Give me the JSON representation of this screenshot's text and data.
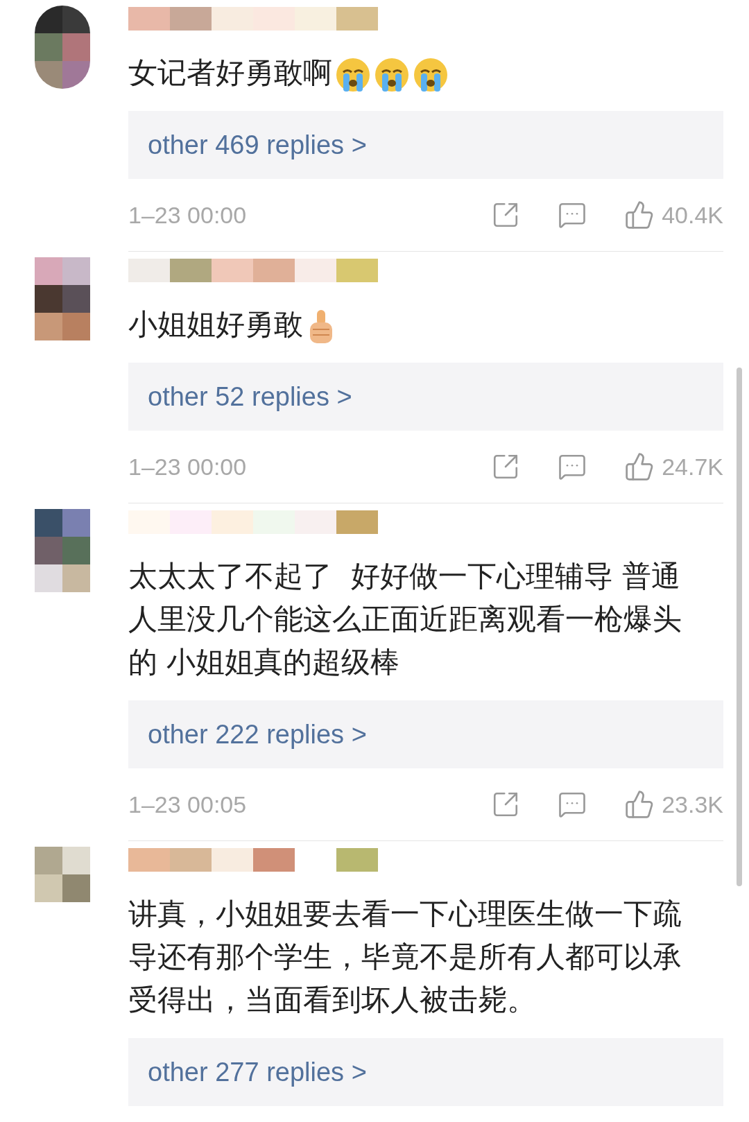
{
  "comments": [
    {
      "text": "女记者好勇敢啊",
      "emoji": [
        {
          "kind": "crying"
        },
        {
          "kind": "crying"
        },
        {
          "kind": "crying"
        }
      ],
      "replies": "other 469 replies >",
      "time": "1–23 00:00",
      "likes": "40.4K"
    },
    {
      "text": "小姐姐好勇敢",
      "emoji": [
        {
          "kind": "thumbs-up"
        }
      ],
      "replies": "other 52 replies >",
      "time": "1–23 00:00",
      "likes": "24.7K"
    },
    {
      "text": "太太太了不起了  好好做一下心理辅导 普通人里没几个能这么正面近距离观看一枪爆头的 小姐姐真的超级棒",
      "replies": "other 222 replies >",
      "time": "1–23 00:05",
      "likes": "23.3K"
    },
    {
      "text": "讲真，小姐姐要去看一下心理医生做一下疏导还有那个学生，毕竟不是所有人都可以承受得出，当面看到坏人被击毙。",
      "replies": "other 277 replies >"
    }
  ]
}
